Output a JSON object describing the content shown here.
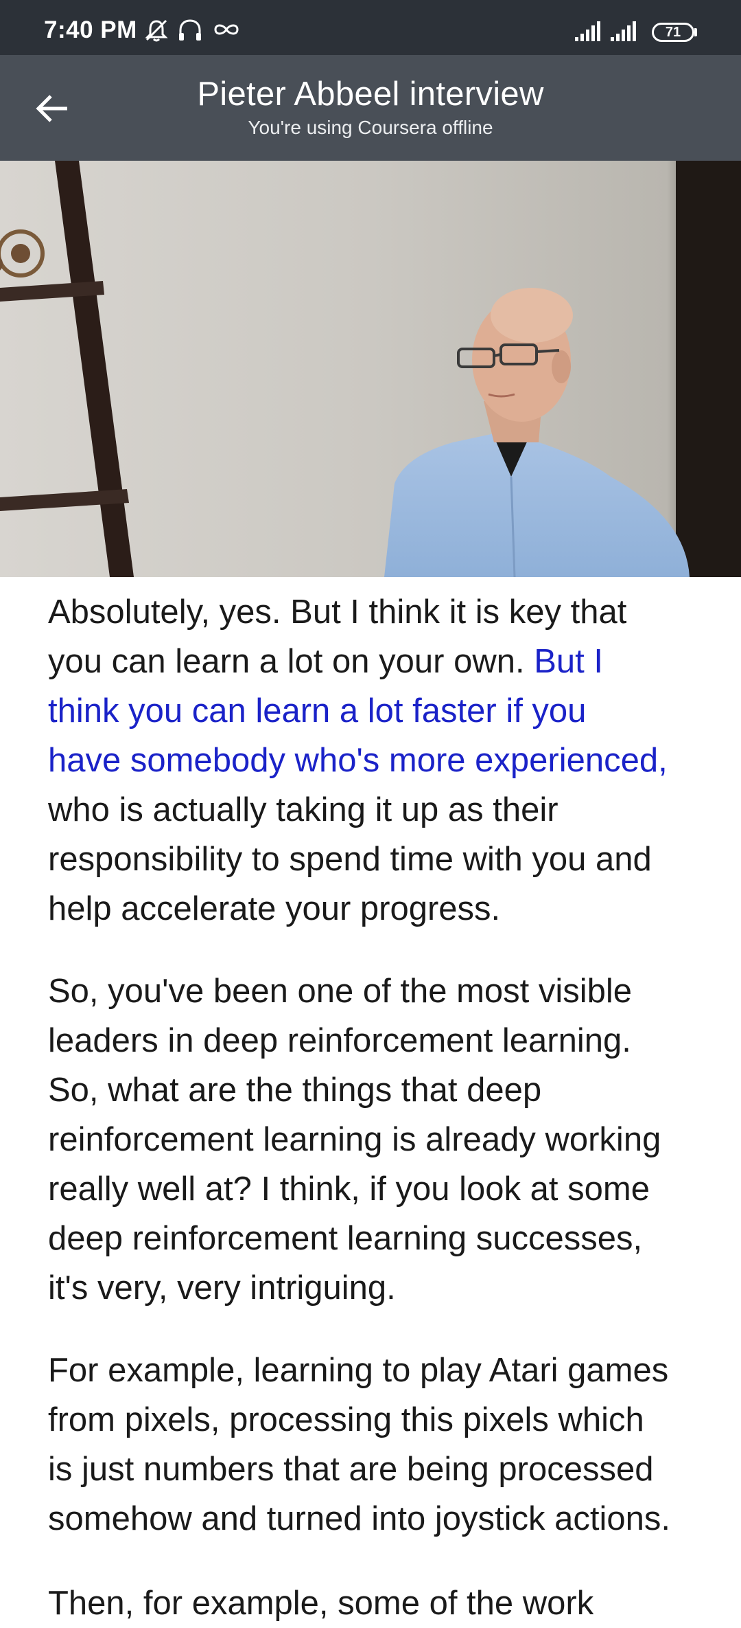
{
  "status_bar": {
    "time": "7:40 PM",
    "battery": "71",
    "icons": [
      "muted-bell-icon",
      "headphones-icon",
      "infinity-icon",
      "signal-icon",
      "signal-icon",
      "battery-icon"
    ]
  },
  "app_bar": {
    "title": "Pieter Abbeel interview",
    "subtitle": "You're using Coursera offline",
    "back_icon": "arrow-left-icon"
  },
  "video": {
    "description_icon": "video-frame"
  },
  "transcript": {
    "p1_l1": "Absolutely, yes.  But I think it is key that",
    "p1_l2_plain": "you can learn a lot on your own. ",
    "p1_l2_highlight": "But I",
    "p1_l3": "think you can learn a lot faster if you",
    "p1_l4": "have somebody who's more experienced,",
    "p1_l5": "who is actually taking it up as their",
    "p1_l6": "responsibility to spend time with you and",
    "p1_l7": "help accelerate your progress.",
    "p2_l1": "So, you've been one of the most visible",
    "p2_l2": "leaders in deep reinforcement learning.",
    "p2_l3": "So, what are the things that deep",
    "p2_l4": "reinforcement learning is already working",
    "p2_l5": "really well at? I think, if you look at some",
    "p2_l6": "deep reinforcement learning successes,",
    "p2_l7": "it's very, very intriguing.",
    "p3_l1": "For example, learning to play Atari games",
    "p3_l2": "from pixels, processing this pixels which",
    "p3_l3": "is just numbers that are being processed",
    "p3_l4": "somehow and turned into joystick actions.",
    "p4_partial": "Then, for example, some of the work"
  },
  "colors": {
    "status_bar": "#2c3138",
    "app_bar": "#494f57",
    "highlight": "#1a22c8",
    "text": "#1a1a1a"
  }
}
